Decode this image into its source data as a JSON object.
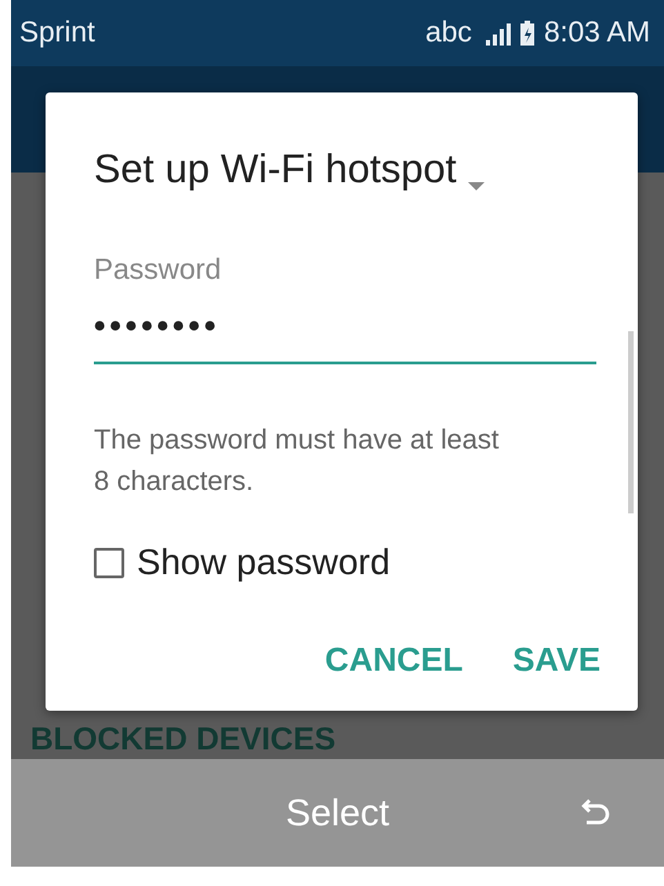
{
  "status_bar": {
    "carrier": "Sprint",
    "keyboard_mode": "abc",
    "time": "8:03 AM"
  },
  "background": {
    "section_header": "BLOCKED DEVICES"
  },
  "dialog": {
    "title": "Set up Wi-Fi hotspot",
    "password": {
      "label": "Password",
      "value": "••••••••"
    },
    "hint": "The password must have at least 8 characters.",
    "show_password": {
      "label": "Show password",
      "checked": false
    },
    "buttons": [
      "CANCEL",
      "SAVE"
    ]
  },
  "softkeys": {
    "center": "Select"
  }
}
